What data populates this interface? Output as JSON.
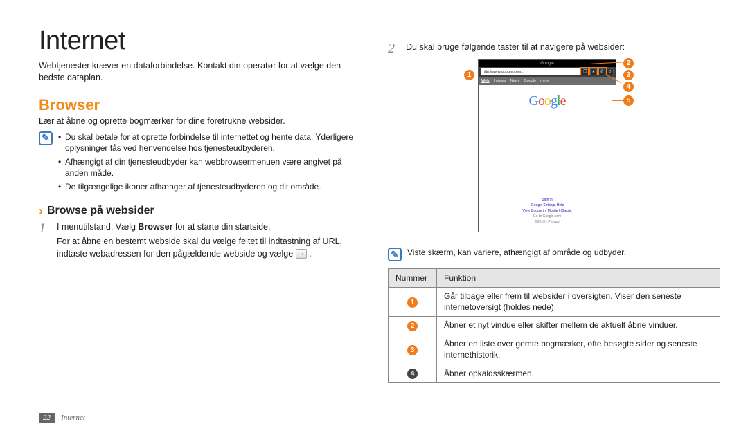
{
  "page": {
    "title": "Internet",
    "intro": "Webtjenester kræver en dataforbindelse. Kontakt din operatør for at vælge den bedste dataplan.",
    "footer_page": "22",
    "footer_section": "Internet"
  },
  "browser": {
    "heading": "Browser",
    "sub": "Lær at åbne og oprette bogmærker for dine foretrukne websider.",
    "notes": [
      "Du skal betale for at oprette forbindelse til internettet og hente data. Yderligere oplysninger fås ved henvendelse hos tjenesteudbyderen.",
      "Afhængigt af din tjenesteudbyder kan webbrowsermenuen være angivet på anden måde.",
      "De tilgængelige ikoner afhænger af tjenesteudbyderen og dit område."
    ]
  },
  "browse": {
    "heading": "Browse på websider",
    "step1_prefix": "I menutilstand: Vælg ",
    "step1_bold": "Browser",
    "step1_suffix": " for at starte din startside.",
    "step1_line2": "For at åbne en bestemt webside skal du vælge feltet til indtastning af URL, indtaste webadressen for den pågældende webside og vælge ",
    "step2": "Du skal bruge følgende taster til at navigere på websider:"
  },
  "figure": {
    "status": "Google",
    "url": "http://www.google.com...",
    "tabs": [
      "Web",
      "Images",
      "News",
      "Google",
      "more"
    ],
    "footer_lines": [
      "Sign in",
      "iGoogle   Settings   Help",
      "View Google in: Mobile | Classic",
      "Go to Google.com",
      "©2010 - Privacy"
    ]
  },
  "note_inline": "Viste skærm, kan variere, afhængigt af område og udbyder.",
  "table": {
    "col1": "Nummer",
    "col2": "Funktion",
    "rows": [
      {
        "n": "1",
        "f": "Går tilbage eller frem til websider i oversigten. Viser den seneste internetoversigt (holdes nede)."
      },
      {
        "n": "2",
        "f": "Åbner et nyt vindue eller skifter mellem de aktuelt åbne vinduer."
      },
      {
        "n": "3",
        "f": "Åbner en liste over gemte bogmærker, ofte besøgte sider og seneste internethistorik."
      },
      {
        "n": "4",
        "f": "Åbner opkaldsskærmen."
      }
    ]
  },
  "icons": {
    "note": "note-icon",
    "chevron": "chevron-right",
    "go": "go-arrow"
  }
}
